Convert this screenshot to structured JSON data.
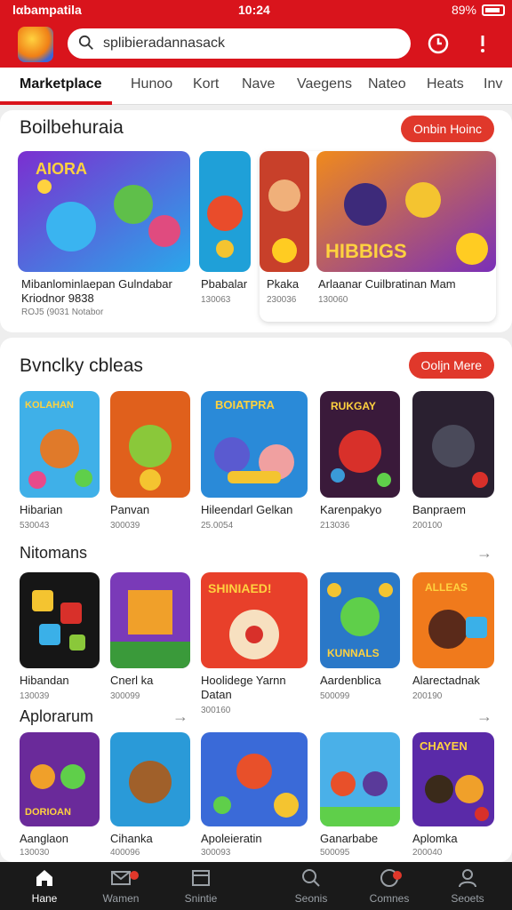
{
  "status": {
    "carrier": "lαbampatila",
    "time": "10:24",
    "battery": "89%"
  },
  "search": {
    "text": "splibieradannasack"
  },
  "tabs": [
    {
      "label": "Marketplace",
      "active": true
    },
    {
      "label": "Hunoo"
    },
    {
      "label": "Kort"
    },
    {
      "label": "Nave"
    },
    {
      "label": "Vaegens"
    },
    {
      "label": "Nateo"
    },
    {
      "label": "Heats"
    },
    {
      "label": "Inv"
    }
  ],
  "featured": {
    "title": "Boilbehuraia",
    "button": "Onbin Hoinc",
    "cards": [
      {
        "title": "Mibanlominlaepan Gulndabar",
        "line2": "Kriodnor 9838",
        "meta": "ROJ5 (9031 Notabor",
        "banner": "AIORA"
      },
      {
        "title": "Pbabalar",
        "meta": "130063"
      },
      {
        "title": "Pkaka",
        "meta": "230036"
      },
      {
        "title": "Arlaanar Cuilbratinan Mam",
        "meta": "130060",
        "banner": "HIBBIGS"
      }
    ]
  },
  "section2": {
    "title": "Bvnclky cbleas",
    "button": "Ooljn Mere",
    "row1": [
      {
        "title": "Hibarian",
        "meta": "530043",
        "banner": "KOLAHAN"
      },
      {
        "title": "Panvan",
        "meta": "300039"
      },
      {
        "title": "Hileendarl Gelkan",
        "meta": "25.0054",
        "banner": "BOIATPRA"
      },
      {
        "title": "Karenpakyo",
        "meta": "213036",
        "banner": "RUKGAY"
      },
      {
        "title": "Banpraem",
        "meta": "200100"
      }
    ],
    "row2_title": "Nitomans",
    "row2": [
      {
        "title": "Hibandan",
        "meta": "130039"
      },
      {
        "title": "Cnerl ka",
        "meta": "300099"
      },
      {
        "title": "Hoolidege Yarnn",
        "line2": "Datan",
        "meta": "300160",
        "banner": "SHINIAED!"
      },
      {
        "title": "Aardenblica",
        "meta": "500099",
        "banner": "KUNNALS"
      },
      {
        "title": "Alarectadnak",
        "meta": "200190",
        "banner": "ALLEAS"
      }
    ],
    "row3_title": "Aplorarum",
    "row3": [
      {
        "title": "Aanglaon",
        "meta": "130030",
        "banner": "DORIOAN"
      },
      {
        "title": "Cihanka",
        "meta": "400096"
      },
      {
        "title": "Apoleieratin",
        "meta": "300093"
      },
      {
        "title": "Ganarbabe",
        "meta": "500095"
      },
      {
        "title": "Aplomka",
        "meta": "200040",
        "banner": "CHAYEN"
      }
    ]
  },
  "nav": [
    {
      "label": "Hane",
      "icon": "home-icon",
      "active": true
    },
    {
      "label": "Wamen",
      "icon": "mail-icon"
    },
    {
      "label": "Snintie",
      "icon": "store-icon"
    },
    {
      "label": "Seonis",
      "icon": "search-icon"
    },
    {
      "label": "Comnes",
      "icon": "chat-icon"
    },
    {
      "label": "Seoets",
      "icon": "profile-icon"
    }
  ],
  "colors": {
    "brand": "#d9141c",
    "accent": "#e0382b"
  }
}
